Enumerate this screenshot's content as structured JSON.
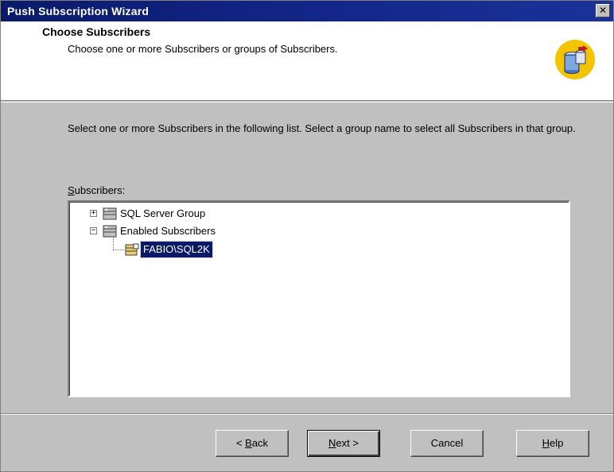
{
  "window": {
    "title": "Push Subscription Wizard",
    "close_glyph": "✕"
  },
  "header": {
    "title": "Choose Subscribers",
    "subtitle": "Choose one or more Subscribers or groups of Subscribers.",
    "icon": "database-wizard-icon"
  },
  "body": {
    "instructions": "Select one or more Subscribers in the following list. Select a group name to select all Subscribers in that group.",
    "subscribers_label_access_key": "S",
    "subscribers_label_rest": "ubscribers:"
  },
  "tree": {
    "items": [
      {
        "label": "SQL Server Group",
        "expander": "+",
        "icon": "server-group-icon",
        "selected": false
      },
      {
        "label": "Enabled Subscribers",
        "expander": "−",
        "icon": "server-group-icon",
        "selected": false
      },
      {
        "label": "FABIO\\SQL2K",
        "expander": "",
        "icon": "server-icon",
        "selected": true
      }
    ]
  },
  "buttons": {
    "back": {
      "prefix": "< ",
      "access_key": "B",
      "rest": "ack"
    },
    "next": {
      "access_key": "N",
      "rest": "ext >"
    },
    "cancel": {
      "label": "Cancel"
    },
    "help": {
      "access_key": "H",
      "rest": "elp"
    }
  },
  "colors": {
    "titlebar": "#0a1a6b",
    "selection": "#0a1a6b",
    "dialog_face": "#c0c0c0",
    "icon_circle": "#f5c400"
  }
}
